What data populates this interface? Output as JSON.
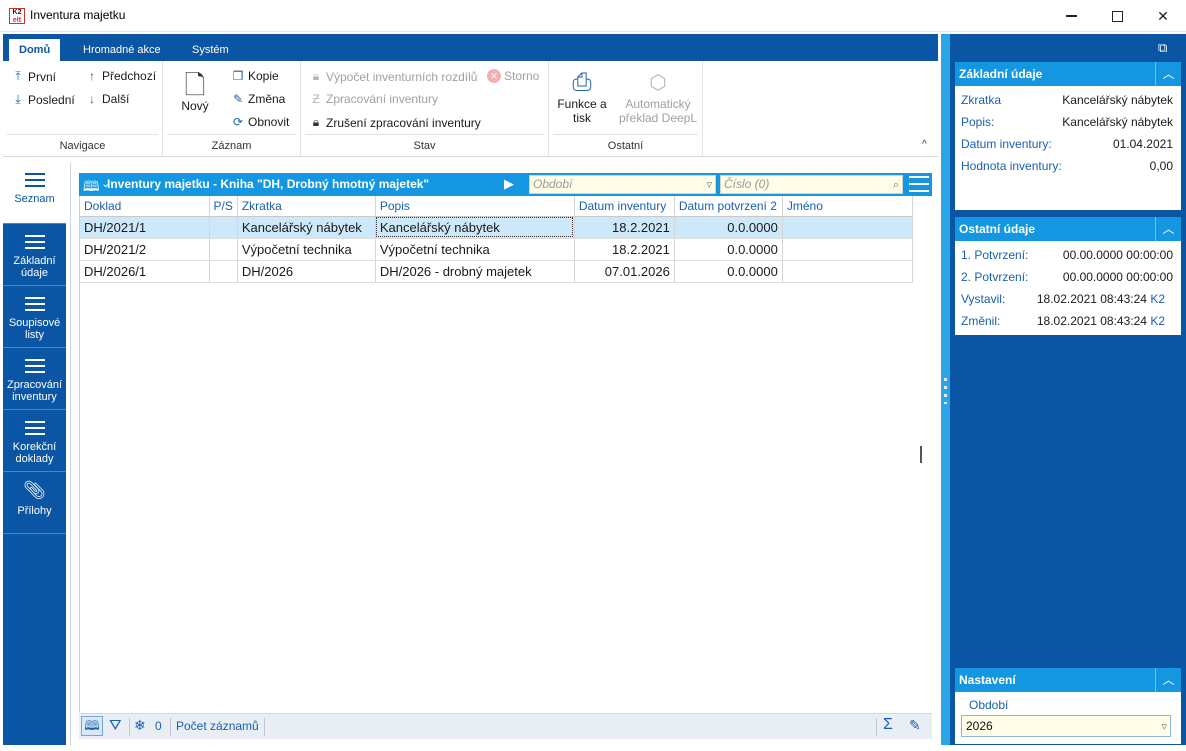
{
  "window": {
    "logo_top": "K2",
    "logo_bottom": "elt",
    "title": "Inventura majetku"
  },
  "ribbon": {
    "tabs": [
      "Domů",
      "Hromadné akce",
      "Systém"
    ],
    "navigace": {
      "label": "Navigace",
      "prvni": "První",
      "posledni": "Poslední",
      "predchozi": "Předchozí",
      "dalsi": "Další"
    },
    "zaznam": {
      "label": "Záznam",
      "novy": "Nový",
      "kopie": "Kopie",
      "zmena": "Změna",
      "obnovit": "Obnovit"
    },
    "stav": {
      "label": "Stav",
      "vypocet": "Výpočet inventurních rozdílů",
      "storno": "Storno",
      "zpracovani": "Zpracování inventury",
      "zruseni": "Zrušení zpracování inventury"
    },
    "ostatni": {
      "label": "Ostatní",
      "funkce_line1": "Funkce a",
      "funkce_line2": "tisk",
      "preklad_line1": "Automatický",
      "preklad_line2": "překlad DeepL"
    }
  },
  "leftnav": [
    {
      "line1": "Seznam",
      "line2": ""
    },
    {
      "line1": "Základní",
      "line2": "údaje"
    },
    {
      "line1": "Soupisové",
      "line2": "listy"
    },
    {
      "line1": "Zpracování",
      "line2": "inventury"
    },
    {
      "line1": "Korekční",
      "line2": "doklady"
    },
    {
      "line1": "Přílohy",
      "line2": ""
    }
  ],
  "grid": {
    "title": "Inventury majetku - Kniha \"DH, Drobný hmotný majetek\"",
    "filter_obdobi_placeholder": "Období",
    "filter_cislo_placeholder": "Číslo (0)",
    "columns": [
      "Doklad",
      "P/S",
      "Zkratka",
      "Popis",
      "Datum inventury",
      "Datum potvrzení 2",
      "Jméno"
    ],
    "rows": [
      [
        "DH/2021/1",
        "",
        "Kancelářský nábytek",
        "Kancelářský nábytek",
        "18.2.2021",
        "0.0.0000",
        ""
      ],
      [
        "DH/2021/2",
        "",
        "Výpočetní technika",
        "Výpočetní technika",
        "18.2.2021",
        "0.0.0000",
        ""
      ],
      [
        "DH/2026/1",
        "",
        "DH/2026",
        "DH/2026 - drobný majetek",
        "07.01.2026",
        "0.0.0000",
        ""
      ]
    ],
    "selected_row": 0
  },
  "statusbar": {
    "snowflake_count": "0",
    "pocet_zaznamu": "Počet záznamů"
  },
  "panels": {
    "zakladni": {
      "title": "Základní údaje",
      "rows": [
        {
          "label": "Zkratka",
          "value": "Kancelářský nábytek"
        },
        {
          "label": "Popis:",
          "value": "Kancelářský nábytek"
        },
        {
          "label": "Datum inventury:",
          "value": "01.04.2021"
        },
        {
          "label": "Hodnota inventury:",
          "value": "0,00"
        }
      ]
    },
    "ostatni": {
      "title": "Ostatní údaje",
      "rows": [
        {
          "label": "1. Potvrzení:",
          "value": "00.00.0000 00:00:00",
          "user": ""
        },
        {
          "label": "2. Potvrzení:",
          "value": "00.00.0000 00:00:00",
          "user": ""
        },
        {
          "label": "Vystavil:",
          "value": "18.02.2021 08:43:24",
          "user": "K2"
        },
        {
          "label": "Změnil:",
          "value": "18.02.2021 08:43:24",
          "user": "K2"
        }
      ]
    },
    "nastaveni": {
      "title": "Nastavení",
      "obdobi_label": "Období",
      "obdobi_value": "2026"
    }
  },
  "colors": {
    "ribbon_blue": "#0b56a4",
    "accent_cyan": "#1497e0",
    "selection": "#cde8f8"
  }
}
